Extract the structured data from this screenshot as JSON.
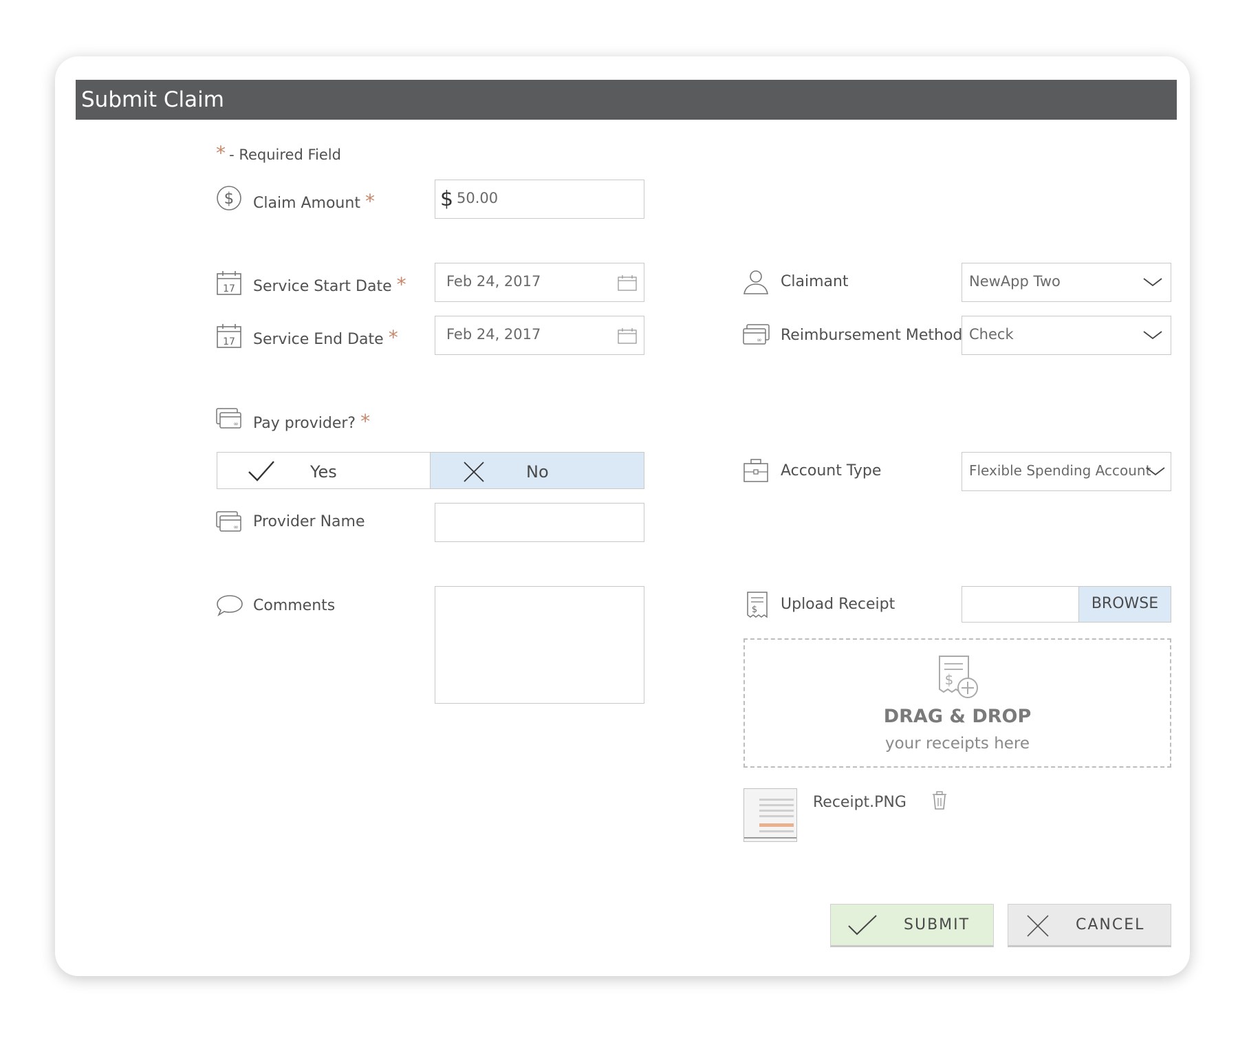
{
  "dialog": {
    "title": "Submit Claim"
  },
  "legend": {
    "star": "*",
    "text": "- Required Field"
  },
  "fields": {
    "claim_amount": {
      "label": "Claim Amount",
      "currency": "$",
      "value": "50.00"
    },
    "service_start": {
      "label": "Service Start Date",
      "value": "Feb 24, 2017"
    },
    "service_end": {
      "label": "Service End Date",
      "value": "Feb 24, 2017"
    },
    "pay_provider": {
      "label": "Pay provider?",
      "yes": "Yes",
      "no": "No",
      "selected": "No"
    },
    "provider_name": {
      "label": "Provider Name",
      "value": ""
    },
    "comments": {
      "label": "Comments",
      "value": ""
    },
    "claimant": {
      "label": "Claimant",
      "value": "NewApp Two"
    },
    "reimbursement": {
      "label": "Reimbursement Method",
      "value": "Check"
    },
    "account_type": {
      "label": "Account Type",
      "value": "Flexible Spending Account"
    },
    "upload": {
      "label": "Upload Receipt",
      "browse": "BROWSE"
    }
  },
  "star": "*",
  "dropzone": {
    "title": "DRAG & DROP",
    "subtitle": "your receipts here"
  },
  "attachment": {
    "filename": "Receipt.PNG"
  },
  "actions": {
    "submit": "SUBMIT",
    "cancel": "CANCEL"
  },
  "colors": {
    "titlebar": "#5a5b5d",
    "accent_star": "#c8876a",
    "selected_blue": "#dbe8f6",
    "submit_green": "#e3f0da",
    "cancel_gray": "#eaeaea"
  }
}
